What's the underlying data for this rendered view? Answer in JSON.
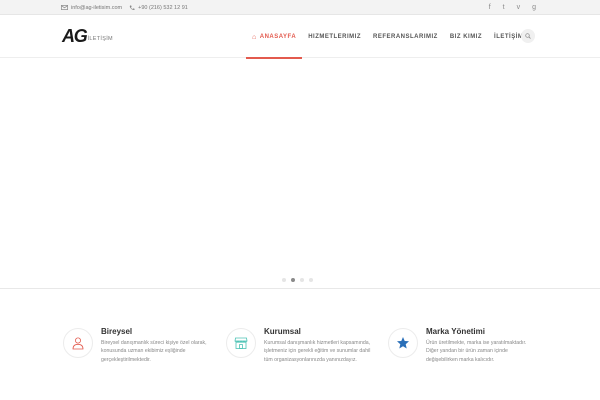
{
  "topbar": {
    "email": "info@ag-iletisim.com",
    "phone": "+90 (216) 532 12 91",
    "social": [
      {
        "icon": "facebook-icon",
        "glyph": "f"
      },
      {
        "icon": "twitter-icon",
        "glyph": "t"
      },
      {
        "icon": "vimeo-icon",
        "glyph": "v"
      },
      {
        "icon": "google-plus-icon",
        "glyph": "g"
      }
    ]
  },
  "logo": {
    "mark": "AG",
    "text": "İLETİŞİM"
  },
  "nav": {
    "home_glyph": "⌂",
    "items": [
      {
        "label": "ANASAYFA",
        "active": true
      },
      {
        "label": "HIZMETLERIMIZ",
        "active": false
      },
      {
        "label": "REFERANSLARIMIZ",
        "active": false
      },
      {
        "label": "BIZ KIMIZ",
        "active": false
      },
      {
        "label": "İLETİŞİM",
        "active": false
      }
    ]
  },
  "slider": {
    "dots": 4,
    "active_dot": 1
  },
  "features": [
    {
      "icon": "user-icon",
      "title": "Bireysel",
      "desc": "Bireysel danışmanlık süreci kişiye özel olarak, konusunda uzman ekibimiz eşliğinde gerçekleştirilmektedir."
    },
    {
      "icon": "store-icon",
      "title": "Kurumsal",
      "desc": "Kurumsal danışmanlık hizmetleri kapsamında, işletmeniz için gerekli eğitim ve sunumlar dahil tüm organizasyonlarınızda yanınızdayız."
    },
    {
      "icon": "star-icon",
      "title": "Marka Yönetimi",
      "desc": "Ürün üretilmekte, marka ise yaratılmaktadır. Diğer yandan bir ürün zaman içinde değişebilirken marka kalıcıdır."
    }
  ],
  "colors": {
    "accent": "#e35a4e",
    "star": "#2a6fb8",
    "store": "#4cc3b5"
  }
}
